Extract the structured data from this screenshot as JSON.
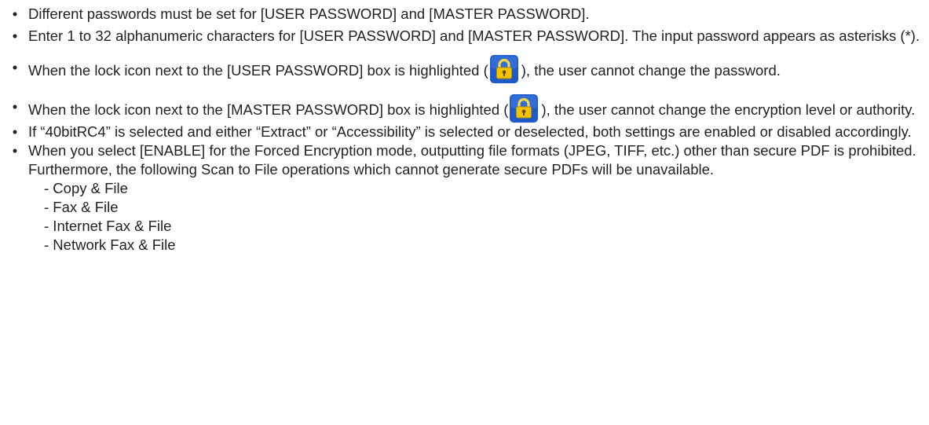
{
  "bullets": {
    "b1": "Different passwords must be set for [USER PASSWORD] and [MASTER PASSWORD].",
    "b2": "Enter 1 to 32 alphanumeric characters for [USER PASSWORD] and [MASTER PASSWORD]. The input password appears as asterisks (*).",
    "b3_before": "When the lock icon next to the [USER PASSWORD] box is highlighted (",
    "b3_after": "), the user cannot change the password.",
    "b4_before": "When the lock icon next to the [MASTER PASSWORD] box is highlighted (",
    "b4_after": "), the user cannot change the encryption level or authority.",
    "b5": "If “40bitRC4” is selected and either “Extract” or “Accessibility” is selected or deselected, both settings are enabled or disabled accordingly.",
    "b6": "When you select [ENABLE] for the Forced Encryption mode, outputting file formats (JPEG, TIFF, etc.) other than secure PDF is prohibited. Furthermore, the following Scan to File operations which cannot generate secure PDFs will be unavailable."
  },
  "sublist": [
    "- Copy & File",
    "- Fax & File",
    "- Internet Fax & File",
    "- Network Fax & File"
  ],
  "icons": {
    "lock": "lock-icon"
  },
  "colors": {
    "text": "#222222",
    "lock_bg": "#1f5bc8",
    "lock_body": "#f2c200"
  }
}
